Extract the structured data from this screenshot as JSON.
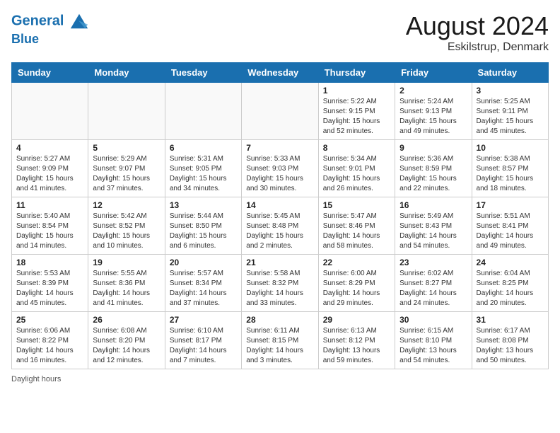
{
  "header": {
    "logo_line1": "General",
    "logo_line2": "Blue",
    "month_year": "August 2024",
    "location": "Eskilstrup, Denmark"
  },
  "calendar": {
    "days_of_week": [
      "Sunday",
      "Monday",
      "Tuesday",
      "Wednesday",
      "Thursday",
      "Friday",
      "Saturday"
    ],
    "weeks": [
      [
        {
          "day": "",
          "info": ""
        },
        {
          "day": "",
          "info": ""
        },
        {
          "day": "",
          "info": ""
        },
        {
          "day": "",
          "info": ""
        },
        {
          "day": "1",
          "info": "Sunrise: 5:22 AM\nSunset: 9:15 PM\nDaylight: 15 hours\nand 52 minutes."
        },
        {
          "day": "2",
          "info": "Sunrise: 5:24 AM\nSunset: 9:13 PM\nDaylight: 15 hours\nand 49 minutes."
        },
        {
          "day": "3",
          "info": "Sunrise: 5:25 AM\nSunset: 9:11 PM\nDaylight: 15 hours\nand 45 minutes."
        }
      ],
      [
        {
          "day": "4",
          "info": "Sunrise: 5:27 AM\nSunset: 9:09 PM\nDaylight: 15 hours\nand 41 minutes."
        },
        {
          "day": "5",
          "info": "Sunrise: 5:29 AM\nSunset: 9:07 PM\nDaylight: 15 hours\nand 37 minutes."
        },
        {
          "day": "6",
          "info": "Sunrise: 5:31 AM\nSunset: 9:05 PM\nDaylight: 15 hours\nand 34 minutes."
        },
        {
          "day": "7",
          "info": "Sunrise: 5:33 AM\nSunset: 9:03 PM\nDaylight: 15 hours\nand 30 minutes."
        },
        {
          "day": "8",
          "info": "Sunrise: 5:34 AM\nSunset: 9:01 PM\nDaylight: 15 hours\nand 26 minutes."
        },
        {
          "day": "9",
          "info": "Sunrise: 5:36 AM\nSunset: 8:59 PM\nDaylight: 15 hours\nand 22 minutes."
        },
        {
          "day": "10",
          "info": "Sunrise: 5:38 AM\nSunset: 8:57 PM\nDaylight: 15 hours\nand 18 minutes."
        }
      ],
      [
        {
          "day": "11",
          "info": "Sunrise: 5:40 AM\nSunset: 8:54 PM\nDaylight: 15 hours\nand 14 minutes."
        },
        {
          "day": "12",
          "info": "Sunrise: 5:42 AM\nSunset: 8:52 PM\nDaylight: 15 hours\nand 10 minutes."
        },
        {
          "day": "13",
          "info": "Sunrise: 5:44 AM\nSunset: 8:50 PM\nDaylight: 15 hours\nand 6 minutes."
        },
        {
          "day": "14",
          "info": "Sunrise: 5:45 AM\nSunset: 8:48 PM\nDaylight: 15 hours\nand 2 minutes."
        },
        {
          "day": "15",
          "info": "Sunrise: 5:47 AM\nSunset: 8:46 PM\nDaylight: 14 hours\nand 58 minutes."
        },
        {
          "day": "16",
          "info": "Sunrise: 5:49 AM\nSunset: 8:43 PM\nDaylight: 14 hours\nand 54 minutes."
        },
        {
          "day": "17",
          "info": "Sunrise: 5:51 AM\nSunset: 8:41 PM\nDaylight: 14 hours\nand 49 minutes."
        }
      ],
      [
        {
          "day": "18",
          "info": "Sunrise: 5:53 AM\nSunset: 8:39 PM\nDaylight: 14 hours\nand 45 minutes."
        },
        {
          "day": "19",
          "info": "Sunrise: 5:55 AM\nSunset: 8:36 PM\nDaylight: 14 hours\nand 41 minutes."
        },
        {
          "day": "20",
          "info": "Sunrise: 5:57 AM\nSunset: 8:34 PM\nDaylight: 14 hours\nand 37 minutes."
        },
        {
          "day": "21",
          "info": "Sunrise: 5:58 AM\nSunset: 8:32 PM\nDaylight: 14 hours\nand 33 minutes."
        },
        {
          "day": "22",
          "info": "Sunrise: 6:00 AM\nSunset: 8:29 PM\nDaylight: 14 hours\nand 29 minutes."
        },
        {
          "day": "23",
          "info": "Sunrise: 6:02 AM\nSunset: 8:27 PM\nDaylight: 14 hours\nand 24 minutes."
        },
        {
          "day": "24",
          "info": "Sunrise: 6:04 AM\nSunset: 8:25 PM\nDaylight: 14 hours\nand 20 minutes."
        }
      ],
      [
        {
          "day": "25",
          "info": "Sunrise: 6:06 AM\nSunset: 8:22 PM\nDaylight: 14 hours\nand 16 minutes."
        },
        {
          "day": "26",
          "info": "Sunrise: 6:08 AM\nSunset: 8:20 PM\nDaylight: 14 hours\nand 12 minutes."
        },
        {
          "day": "27",
          "info": "Sunrise: 6:10 AM\nSunset: 8:17 PM\nDaylight: 14 hours\nand 7 minutes."
        },
        {
          "day": "28",
          "info": "Sunrise: 6:11 AM\nSunset: 8:15 PM\nDaylight: 14 hours\nand 3 minutes."
        },
        {
          "day": "29",
          "info": "Sunrise: 6:13 AM\nSunset: 8:12 PM\nDaylight: 13 hours\nand 59 minutes."
        },
        {
          "day": "30",
          "info": "Sunrise: 6:15 AM\nSunset: 8:10 PM\nDaylight: 13 hours\nand 54 minutes."
        },
        {
          "day": "31",
          "info": "Sunrise: 6:17 AM\nSunset: 8:08 PM\nDaylight: 13 hours\nand 50 minutes."
        }
      ]
    ]
  },
  "footer": {
    "daylight_label": "Daylight hours"
  }
}
